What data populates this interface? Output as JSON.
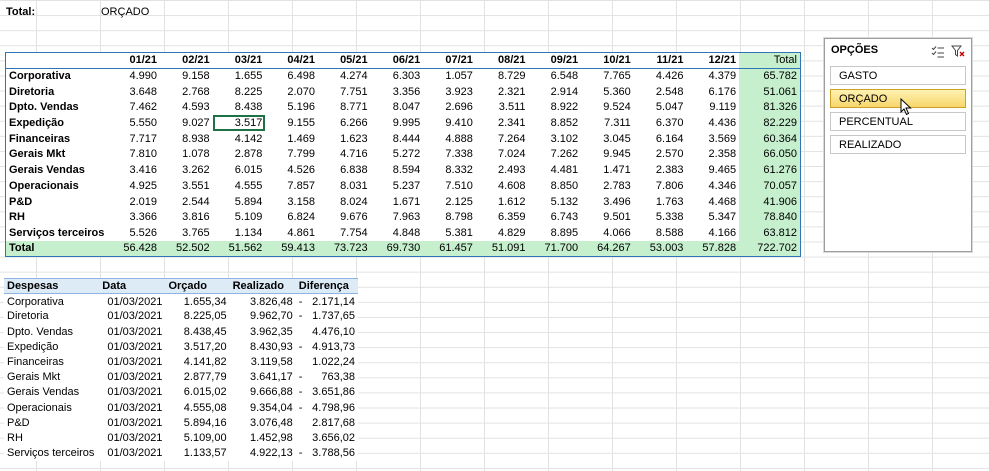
{
  "filter": {
    "label": "Total:",
    "value": "ORÇADO"
  },
  "pivot": {
    "months": [
      "01/21",
      "02/21",
      "03/21",
      "04/21",
      "05/21",
      "06/21",
      "07/21",
      "08/21",
      "09/21",
      "10/21",
      "11/21",
      "12/21"
    ],
    "total_header": "Total",
    "rows": [
      {
        "name": "Corporativa",
        "values": [
          "4.990",
          "9.158",
          "1.655",
          "6.498",
          "4.274",
          "6.303",
          "1.057",
          "8.729",
          "6.548",
          "7.765",
          "4.426",
          "4.379"
        ],
        "total": "65.782"
      },
      {
        "name": "Diretoria",
        "values": [
          "3.648",
          "2.768",
          "8.225",
          "2.070",
          "7.751",
          "3.356",
          "3.923",
          "2.321",
          "2.914",
          "5.360",
          "2.548",
          "6.176"
        ],
        "total": "51.061"
      },
      {
        "name": "Dpto. Vendas",
        "values": [
          "7.462",
          "4.593",
          "8.438",
          "5.196",
          "8.771",
          "8.047",
          "2.696",
          "3.511",
          "8.922",
          "9.524",
          "5.047",
          "9.119"
        ],
        "total": "81.326"
      },
      {
        "name": "Expedição",
        "values": [
          "5.550",
          "9.027",
          "3.517",
          "9.155",
          "6.266",
          "9.995",
          "9.410",
          "2.341",
          "8.852",
          "7.311",
          "6.370",
          "4.436"
        ],
        "total": "82.229"
      },
      {
        "name": "Financeiras",
        "values": [
          "7.717",
          "8.938",
          "4.142",
          "1.469",
          "1.623",
          "8.444",
          "4.888",
          "7.264",
          "3.102",
          "3.045",
          "6.164",
          "3.569"
        ],
        "total": "60.364"
      },
      {
        "name": "Gerais Mkt",
        "values": [
          "7.810",
          "1.078",
          "2.878",
          "7.799",
          "4.716",
          "5.272",
          "7.338",
          "7.024",
          "7.262",
          "9.945",
          "2.570",
          "2.358"
        ],
        "total": "66.050"
      },
      {
        "name": "Gerais Vendas",
        "values": [
          "3.416",
          "3.262",
          "6.015",
          "4.526",
          "6.838",
          "8.594",
          "8.332",
          "2.493",
          "4.481",
          "1.471",
          "2.383",
          "9.465"
        ],
        "total": "61.276"
      },
      {
        "name": "Operacionais",
        "values": [
          "4.925",
          "3.551",
          "4.555",
          "7.857",
          "8.031",
          "5.237",
          "7.510",
          "4.608",
          "8.850",
          "2.783",
          "7.806",
          "4.346"
        ],
        "total": "70.057"
      },
      {
        "name": "P&D",
        "values": [
          "2.019",
          "2.544",
          "5.894",
          "3.158",
          "8.024",
          "1.671",
          "2.125",
          "1.612",
          "5.132",
          "3.496",
          "1.763",
          "4.468"
        ],
        "total": "41.906"
      },
      {
        "name": "RH",
        "values": [
          "3.366",
          "3.816",
          "5.109",
          "6.824",
          "9.676",
          "7.963",
          "8.798",
          "6.359",
          "6.743",
          "9.501",
          "5.338",
          "5.347"
        ],
        "total": "78.840"
      },
      {
        "name": "Serviços terceiros",
        "values": [
          "5.526",
          "3.765",
          "1.134",
          "4.861",
          "7.754",
          "4.848",
          "5.381",
          "4.829",
          "8.895",
          "4.066",
          "8.588",
          "4.166"
        ],
        "total": "63.812"
      }
    ],
    "total_row": {
      "name": "Total",
      "values": [
        "56.428",
        "52.502",
        "51.562",
        "59.413",
        "73.723",
        "69.730",
        "61.457",
        "51.091",
        "71.700",
        "64.267",
        "53.003",
        "57.828"
      ],
      "total": "722.702"
    }
  },
  "detail": {
    "headers": [
      "Despesas",
      "Data",
      "Orçado",
      "Realizado",
      "Diferença"
    ],
    "rows": [
      {
        "name": "Corporativa",
        "date": "01/03/2021",
        "orcado": "1.655,34",
        "realizado": "3.826,48",
        "sign": "-",
        "diff": "2.171,14"
      },
      {
        "name": "Diretoria",
        "date": "01/03/2021",
        "orcado": "8.225,05",
        "realizado": "9.962,70",
        "sign": "-",
        "diff": "1.737,65"
      },
      {
        "name": "Dpto. Vendas",
        "date": "01/03/2021",
        "orcado": "8.438,45",
        "realizado": "3.962,35",
        "sign": "",
        "diff": "4.476,10"
      },
      {
        "name": "Expedição",
        "date": "01/03/2021",
        "orcado": "3.517,20",
        "realizado": "8.430,93",
        "sign": "-",
        "diff": "4.913,73"
      },
      {
        "name": "Financeiras",
        "date": "01/03/2021",
        "orcado": "4.141,82",
        "realizado": "3.119,58",
        "sign": "",
        "diff": "1.022,24"
      },
      {
        "name": "Gerais Mkt",
        "date": "01/03/2021",
        "orcado": "2.877,79",
        "realizado": "3.641,17",
        "sign": "-",
        "diff": "763,38"
      },
      {
        "name": "Gerais Vendas",
        "date": "01/03/2021",
        "orcado": "6.015,02",
        "realizado": "9.666,88",
        "sign": "-",
        "diff": "3.651,86"
      },
      {
        "name": "Operacionais",
        "date": "01/03/2021",
        "orcado": "4.555,08",
        "realizado": "9.354,04",
        "sign": "-",
        "diff": "4.798,96"
      },
      {
        "name": "P&D",
        "date": "01/03/2021",
        "orcado": "5.894,16",
        "realizado": "3.076,48",
        "sign": "",
        "diff": "2.817,68"
      },
      {
        "name": "RH",
        "date": "01/03/2021",
        "orcado": "5.109,00",
        "realizado": "1.452,98",
        "sign": "",
        "diff": "3.656,02"
      },
      {
        "name": "Serviços terceiros",
        "date": "01/03/2021",
        "orcado": "1.133,57",
        "realizado": "4.922,13",
        "sign": "-",
        "diff": "3.788,56"
      }
    ]
  },
  "slicer": {
    "title": "OPÇÕES",
    "items": [
      "GASTO",
      "ORÇADO",
      "PERCENTUAL",
      "REALIZADO"
    ],
    "selected": "ORÇADO"
  },
  "colors": {
    "pivot_border": "#2f75b5",
    "total_fill": "#c6efce",
    "header_fill": "#ddebf7",
    "selected_slicer": "#ffe699"
  }
}
